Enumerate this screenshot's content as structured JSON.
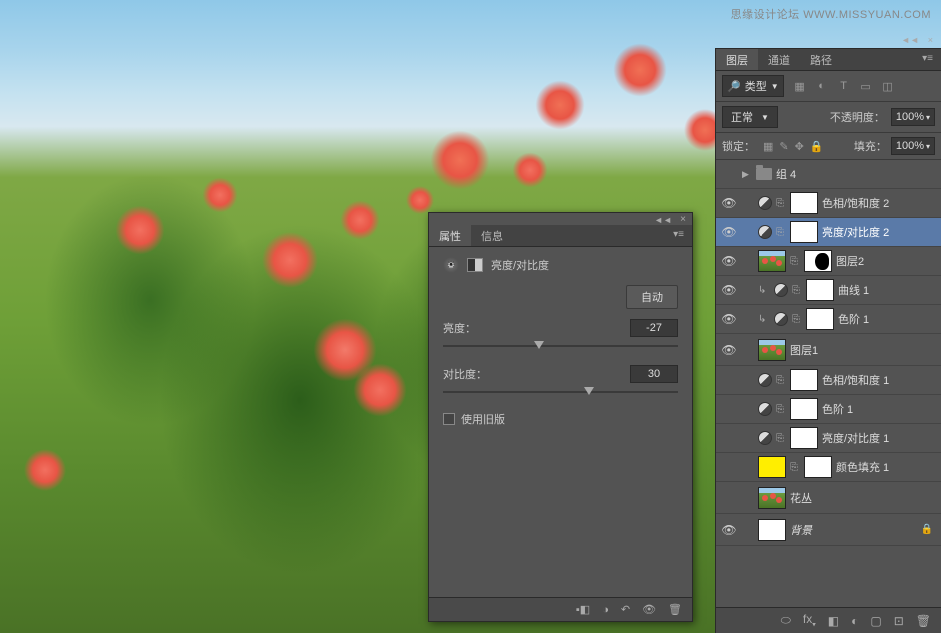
{
  "watermark": "思缘设计论坛  WWW.MISSYUAN.COM",
  "properties_panel": {
    "tabs": {
      "properties": "属性",
      "info": "信息"
    },
    "adjustment_title": "亮度/对比度",
    "auto_button": "自动",
    "brightness": {
      "label": "亮度：",
      "value": "-27",
      "thumb_pct": 41
    },
    "contrast": {
      "label": "对比度：",
      "value": "30",
      "thumb_pct": 62
    },
    "legacy_checkbox": "使用旧版"
  },
  "layers_panel": {
    "tabs": {
      "layers": "图层",
      "channels": "通道",
      "paths": "路径"
    },
    "filter_label": "类型",
    "blend_mode": "正常",
    "opacity_label": "不透明度：",
    "opacity_value": "100%",
    "lock_label": "锁定：",
    "fill_label": "填充：",
    "fill_value": "100%",
    "layers": [
      {
        "name": "组 4"
      },
      {
        "name": "色相/饱和度 2"
      },
      {
        "name": "亮度/对比度 2"
      },
      {
        "name": "图层2"
      },
      {
        "name": "曲线 1"
      },
      {
        "name": "色阶 1"
      },
      {
        "name": "图层1"
      },
      {
        "name": "色相/饱和度 1"
      },
      {
        "name": "色阶 1"
      },
      {
        "name": "亮度/对比度 1"
      },
      {
        "name": "颜色填充 1"
      },
      {
        "name": "花丛"
      },
      {
        "name": "背景"
      }
    ]
  }
}
